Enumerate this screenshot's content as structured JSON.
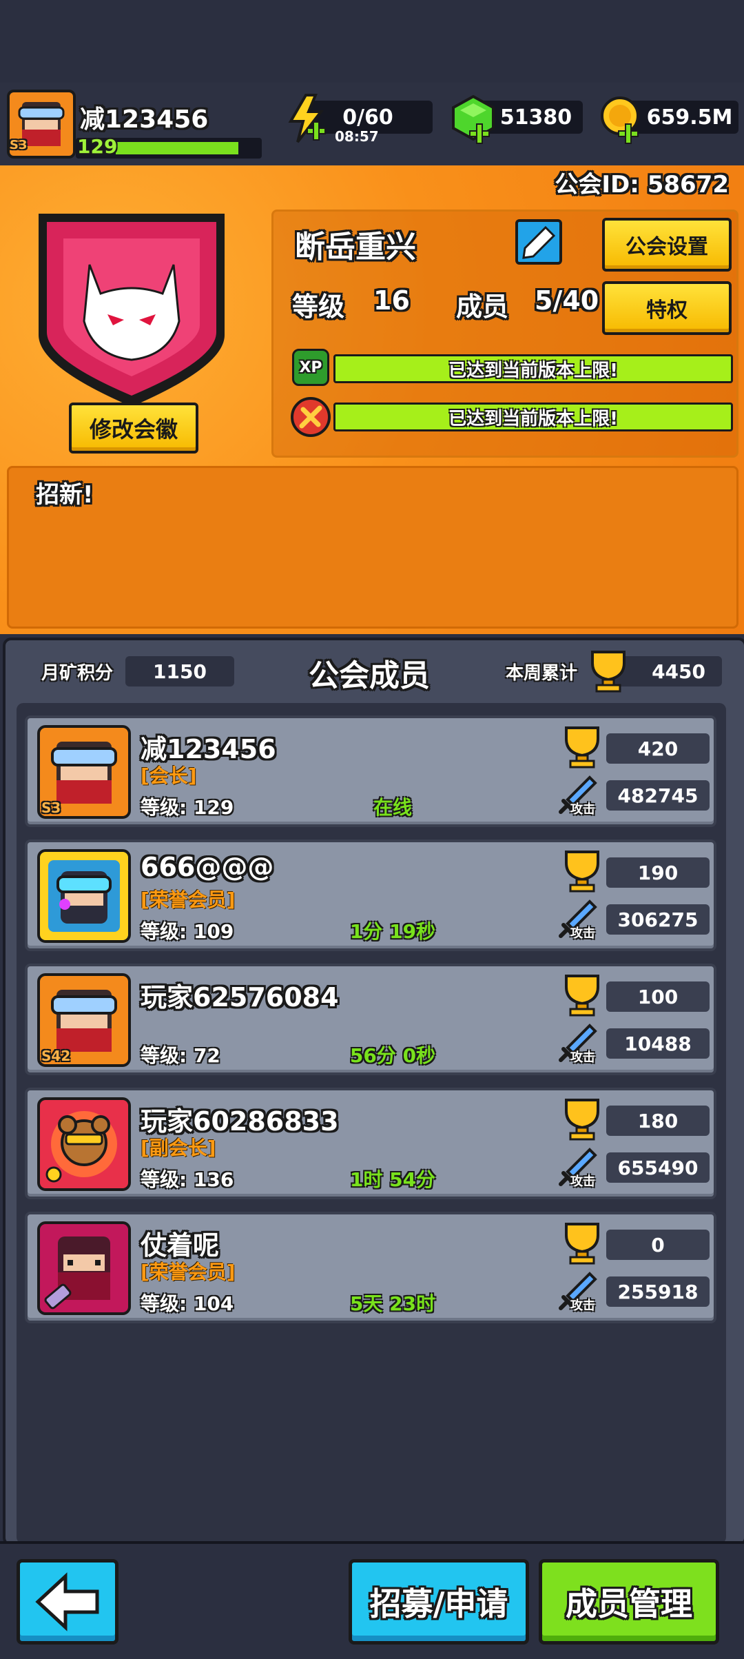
{
  "player": {
    "name": "减123456",
    "level": "129",
    "badge": "S3"
  },
  "resources": {
    "energy": "0/60",
    "energy_timer": "08:57",
    "gems": "51380",
    "coins": "659.5M"
  },
  "guild": {
    "id_label": "公会ID: 58672",
    "name": "断岳重兴",
    "settings_label": "公会设置",
    "level_label": "等级",
    "level_value": "16",
    "members_label": "成员",
    "members_value": "5/40",
    "privilege_label": "特权",
    "xp_tag": "XP",
    "xp_bar_text": "已达到当前版本上限!",
    "second_bar_text": "已达到当前版本上限!",
    "change_emblem_label": "修改会徽",
    "announcement": "招新!"
  },
  "members_panel": {
    "monthly_label": "月矿积分",
    "monthly_value": "1150",
    "title": "公会成员",
    "weekly_label": "本周累计",
    "weekly_value": "4450",
    "level_prefix": "等级:",
    "attack_label": "攻击"
  },
  "members": [
    {
      "name": "减123456",
      "rank": "[会长]",
      "level": "129",
      "status": "在线",
      "trophy": "420",
      "attack": "482745",
      "badge": "S3"
    },
    {
      "name": "666@@@",
      "rank": "[荣誉会员]",
      "level": "109",
      "status": "1分 19秒",
      "trophy": "190",
      "attack": "306275",
      "badge": ""
    },
    {
      "name": "玩家62576084",
      "rank": "",
      "level": "72",
      "status": "56分 0秒",
      "trophy": "100",
      "attack": "10488",
      "badge": "S42"
    },
    {
      "name": "玩家60286833",
      "rank": "[副会长]",
      "level": "136",
      "status": "1时 54分",
      "trophy": "180",
      "attack": "655490",
      "badge": ""
    },
    {
      "name": "仗着呢",
      "rank": "[荣誉会员]",
      "level": "104",
      "status": "5天 23时",
      "trophy": "0",
      "attack": "255918",
      "badge": ""
    }
  ],
  "bottom": {
    "recruit_label": "招募/申请",
    "manage_label": "成员管理"
  },
  "colors": {
    "orange": "#f7901a",
    "yellow": "#ffd21f",
    "green": "#a6ef1a",
    "cyan": "#22c5f0",
    "panel": "#454b5e"
  }
}
